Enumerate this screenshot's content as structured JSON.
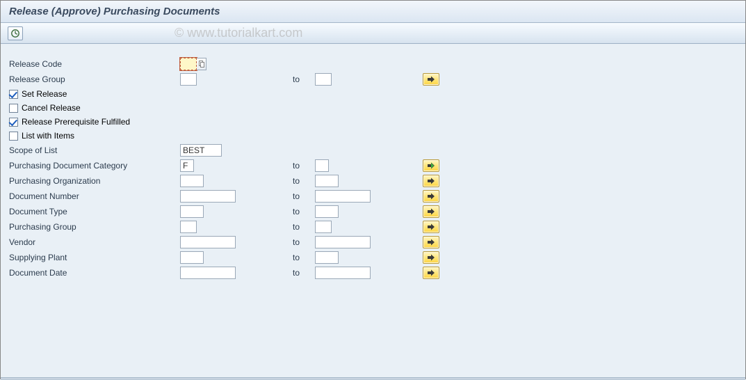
{
  "title": "Release (Approve) Purchasing Documents",
  "watermark": "© www.tutorialkart.com",
  "labels": {
    "release_code": "Release Code",
    "release_group": "Release Group",
    "set_release": "Set Release",
    "cancel_release": "Cancel Release",
    "release_prereq": "Release Prerequisite Fulfilled",
    "list_with_items": "List with Items",
    "scope_of_list": "Scope of List",
    "purch_doc_cat": "Purchasing Document Category",
    "purch_org": "Purchasing Organization",
    "doc_number": "Document Number",
    "doc_type": "Document Type",
    "purch_group": "Purchasing Group",
    "vendor": "Vendor",
    "supplying_plant": "Supplying Plant",
    "doc_date": "Document Date",
    "to": "to"
  },
  "values": {
    "release_code": "",
    "release_group_from": "",
    "release_group_to": "",
    "scope_of_list": "BEST",
    "purch_doc_cat_from": "F",
    "purch_doc_cat_to": "",
    "purch_org_from": "",
    "purch_org_to": "",
    "doc_number_from": "",
    "doc_number_to": "",
    "doc_type_from": "",
    "doc_type_to": "",
    "purch_group_from": "",
    "purch_group_to": "",
    "vendor_from": "",
    "vendor_to": "",
    "supplying_plant_from": "",
    "supplying_plant_to": "",
    "doc_date_from": "",
    "doc_date_to": ""
  },
  "checkboxes": {
    "set_release": true,
    "cancel_release": false,
    "release_prereq": true,
    "list_with_items": false
  }
}
